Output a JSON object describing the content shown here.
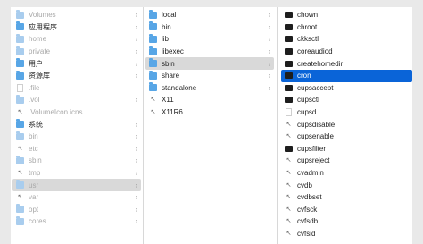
{
  "columns": [
    {
      "items": [
        {
          "label": "Volumes",
          "type": "folder",
          "dim": true,
          "arrow": true
        },
        {
          "label": "应用程序",
          "type": "folder",
          "dim": false,
          "arrow": true
        },
        {
          "label": "home",
          "type": "folder",
          "dim": true,
          "arrow": true
        },
        {
          "label": "private",
          "type": "folder",
          "dim": true,
          "arrow": true
        },
        {
          "label": "用户",
          "type": "folder",
          "dim": false,
          "arrow": true
        },
        {
          "label": "资源库",
          "type": "folder",
          "dim": false,
          "arrow": true
        },
        {
          "label": ".file",
          "type": "doc",
          "dim": true,
          "arrow": false
        },
        {
          "label": ".vol",
          "type": "folder",
          "dim": true,
          "arrow": true
        },
        {
          "label": ".VolumeIcon.icns",
          "type": "alias",
          "dim": true,
          "arrow": false
        },
        {
          "label": "系统",
          "type": "folder",
          "dim": false,
          "arrow": true
        },
        {
          "label": "bin",
          "type": "folder",
          "dim": true,
          "arrow": true
        },
        {
          "label": "etc",
          "type": "alias",
          "dim": true,
          "arrow": true
        },
        {
          "label": "sbin",
          "type": "folder",
          "dim": true,
          "arrow": true
        },
        {
          "label": "tmp",
          "type": "alias",
          "dim": true,
          "arrow": true
        },
        {
          "label": "usr",
          "type": "folder",
          "dim": true,
          "arrow": true,
          "selected": "gray"
        },
        {
          "label": "var",
          "type": "alias",
          "dim": true,
          "arrow": true
        },
        {
          "label": "opt",
          "type": "folder",
          "dim": true,
          "arrow": true
        },
        {
          "label": "cores",
          "type": "folder",
          "dim": true,
          "arrow": true
        }
      ]
    },
    {
      "items": [
        {
          "label": "local",
          "type": "folder",
          "dim": false,
          "arrow": true
        },
        {
          "label": "bin",
          "type": "folder",
          "dim": false,
          "arrow": true
        },
        {
          "label": "lib",
          "type": "folder",
          "dim": false,
          "arrow": true
        },
        {
          "label": "libexec",
          "type": "folder",
          "dim": false,
          "arrow": true
        },
        {
          "label": "sbin",
          "type": "folder",
          "dim": false,
          "arrow": true,
          "selected": "gray"
        },
        {
          "label": "share",
          "type": "folder",
          "dim": false,
          "arrow": true
        },
        {
          "label": "standalone",
          "type": "folder",
          "dim": false,
          "arrow": true
        },
        {
          "label": "X11",
          "type": "alias",
          "dim": false,
          "arrow": false
        },
        {
          "label": "X11R6",
          "type": "alias",
          "dim": false,
          "arrow": false
        }
      ]
    },
    {
      "items": [
        {
          "label": "chown",
          "type": "exec",
          "dim": false,
          "arrow": false
        },
        {
          "label": "chroot",
          "type": "exec",
          "dim": false,
          "arrow": false
        },
        {
          "label": "ckksctl",
          "type": "exec",
          "dim": false,
          "arrow": false
        },
        {
          "label": "coreaudiod",
          "type": "exec",
          "dim": false,
          "arrow": false
        },
        {
          "label": "createhomedir",
          "type": "exec",
          "dim": false,
          "arrow": false
        },
        {
          "label": "cron",
          "type": "exec",
          "dim": false,
          "arrow": false,
          "selected": "blue"
        },
        {
          "label": "cupsaccept",
          "type": "exec",
          "dim": false,
          "arrow": false
        },
        {
          "label": "cupsctl",
          "type": "exec",
          "dim": false,
          "arrow": false
        },
        {
          "label": "cupsd",
          "type": "doc",
          "dim": false,
          "arrow": false
        },
        {
          "label": "cupsdisable",
          "type": "alias",
          "dim": false,
          "arrow": false
        },
        {
          "label": "cupsenable",
          "type": "alias",
          "dim": false,
          "arrow": false
        },
        {
          "label": "cupsfilter",
          "type": "exec",
          "dim": false,
          "arrow": false
        },
        {
          "label": "cupsreject",
          "type": "alias",
          "dim": false,
          "arrow": false
        },
        {
          "label": "cvadmin",
          "type": "alias",
          "dim": false,
          "arrow": false
        },
        {
          "label": "cvdb",
          "type": "alias",
          "dim": false,
          "arrow": false
        },
        {
          "label": "cvdbset",
          "type": "alias",
          "dim": false,
          "arrow": false
        },
        {
          "label": "cvfsck",
          "type": "alias",
          "dim": false,
          "arrow": false
        },
        {
          "label": "cvfsdb",
          "type": "alias",
          "dim": false,
          "arrow": false
        },
        {
          "label": "cvfsid",
          "type": "alias",
          "dim": false,
          "arrow": false
        }
      ]
    }
  ],
  "chevron_glyph": "›",
  "alias_glyph": "↖",
  "colors": {
    "selection_blue": "#0a64d8",
    "selection_gray": "#d9d9d9",
    "folder": "#58a6e6",
    "dim_text": "#a9a9a9"
  }
}
